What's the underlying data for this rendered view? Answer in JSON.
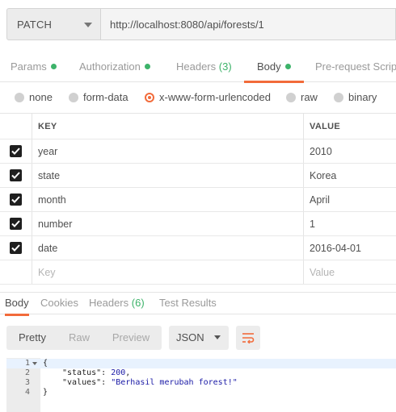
{
  "request": {
    "method": "PATCH",
    "url": "http://localhost:8080/api/forests/1"
  },
  "tabs": [
    {
      "label": "Params",
      "dot": true
    },
    {
      "label": "Authorization",
      "dot": true
    },
    {
      "label": "Headers",
      "count": "(3)"
    },
    {
      "label": "Body",
      "dot": true,
      "active": true
    },
    {
      "label": "Pre-request Script"
    }
  ],
  "body_types": [
    "none",
    "form-data",
    "x-www-form-urlencoded",
    "raw",
    "binary"
  ],
  "body_type_selected": "x-www-form-urlencoded",
  "kv": {
    "key_header": "KEY",
    "value_header": "VALUE",
    "rows": [
      {
        "key": "year",
        "value": "2010",
        "checked": true
      },
      {
        "key": "state",
        "value": "Korea",
        "checked": true
      },
      {
        "key": "month",
        "value": "April",
        "checked": true
      },
      {
        "key": "number",
        "value": "1",
        "checked": true
      },
      {
        "key": "date",
        "value": "2016-04-01",
        "checked": true
      }
    ],
    "key_placeholder": "Key",
    "value_placeholder": "Value"
  },
  "response": {
    "tabs": [
      {
        "label": "Body",
        "active": true
      },
      {
        "label": "Cookies"
      },
      {
        "label": "Headers",
        "count": "(6)"
      },
      {
        "label": "Test Results"
      }
    ],
    "view_modes": [
      "Pretty",
      "Raw",
      "Preview"
    ],
    "active_view": "Pretty",
    "format": "JSON",
    "code": {
      "line_numbers": [
        "1",
        "2",
        "3",
        "4"
      ],
      "open_brace": "{",
      "close_brace": "}",
      "status_key": "\"status\"",
      "status_value": "200",
      "values_key": "\"values\"",
      "values_value": "\"Berhasil merubah forest!\""
    }
  },
  "colors": {
    "accent": "#f26b3a",
    "green_dot": "#3db36a"
  }
}
